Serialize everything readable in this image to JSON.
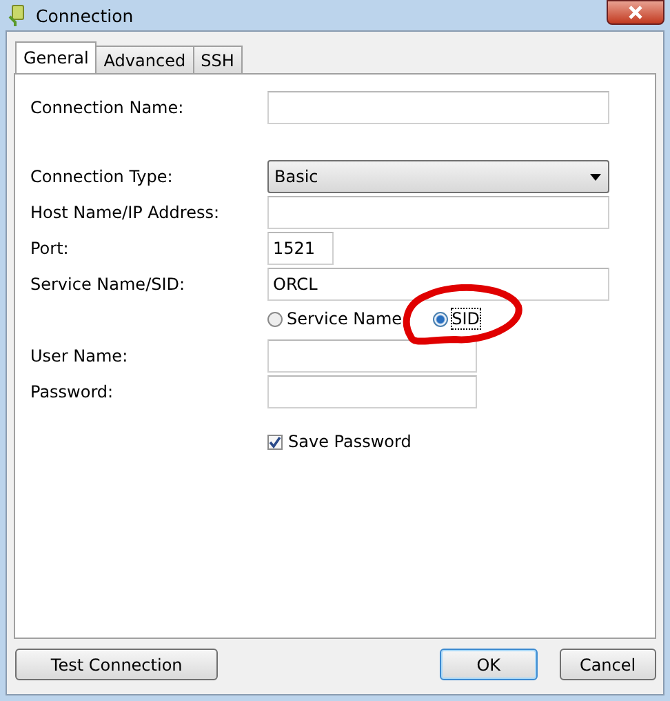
{
  "window": {
    "title": "Connection"
  },
  "tabs": [
    {
      "label": "General",
      "selected": true
    },
    {
      "label": "Advanced",
      "selected": false
    },
    {
      "label": "SSH",
      "selected": false
    }
  ],
  "fields": [
    {
      "kind": "text",
      "label": "Connection Name:"
    },
    {
      "kind": "select",
      "label": "Connection Type:",
      "value": "Basic"
    },
    {
      "kind": "text",
      "label": "Host Name/IP Address:"
    },
    {
      "kind": "short",
      "label": "Port:",
      "value": "1521"
    },
    {
      "kind": "text",
      "label": "Service Name/SID:",
      "value": "ORCL"
    },
    {
      "kind": "radios",
      "options": [
        {
          "label": "Service Name",
          "selected": false
        },
        {
          "label": "SID",
          "selected": true
        }
      ]
    },
    {
      "kind": "medium",
      "label": "User Name:"
    },
    {
      "kind": "medium",
      "label": "Password:"
    },
    {
      "kind": "checkbox",
      "label": "Save Password",
      "checked": true
    }
  ],
  "buttons": [
    {
      "label": "Test Connection",
      "focused": false
    },
    {
      "label": "OK",
      "focused": true
    },
    {
      "label": "Cancel",
      "focused": false
    }
  ]
}
